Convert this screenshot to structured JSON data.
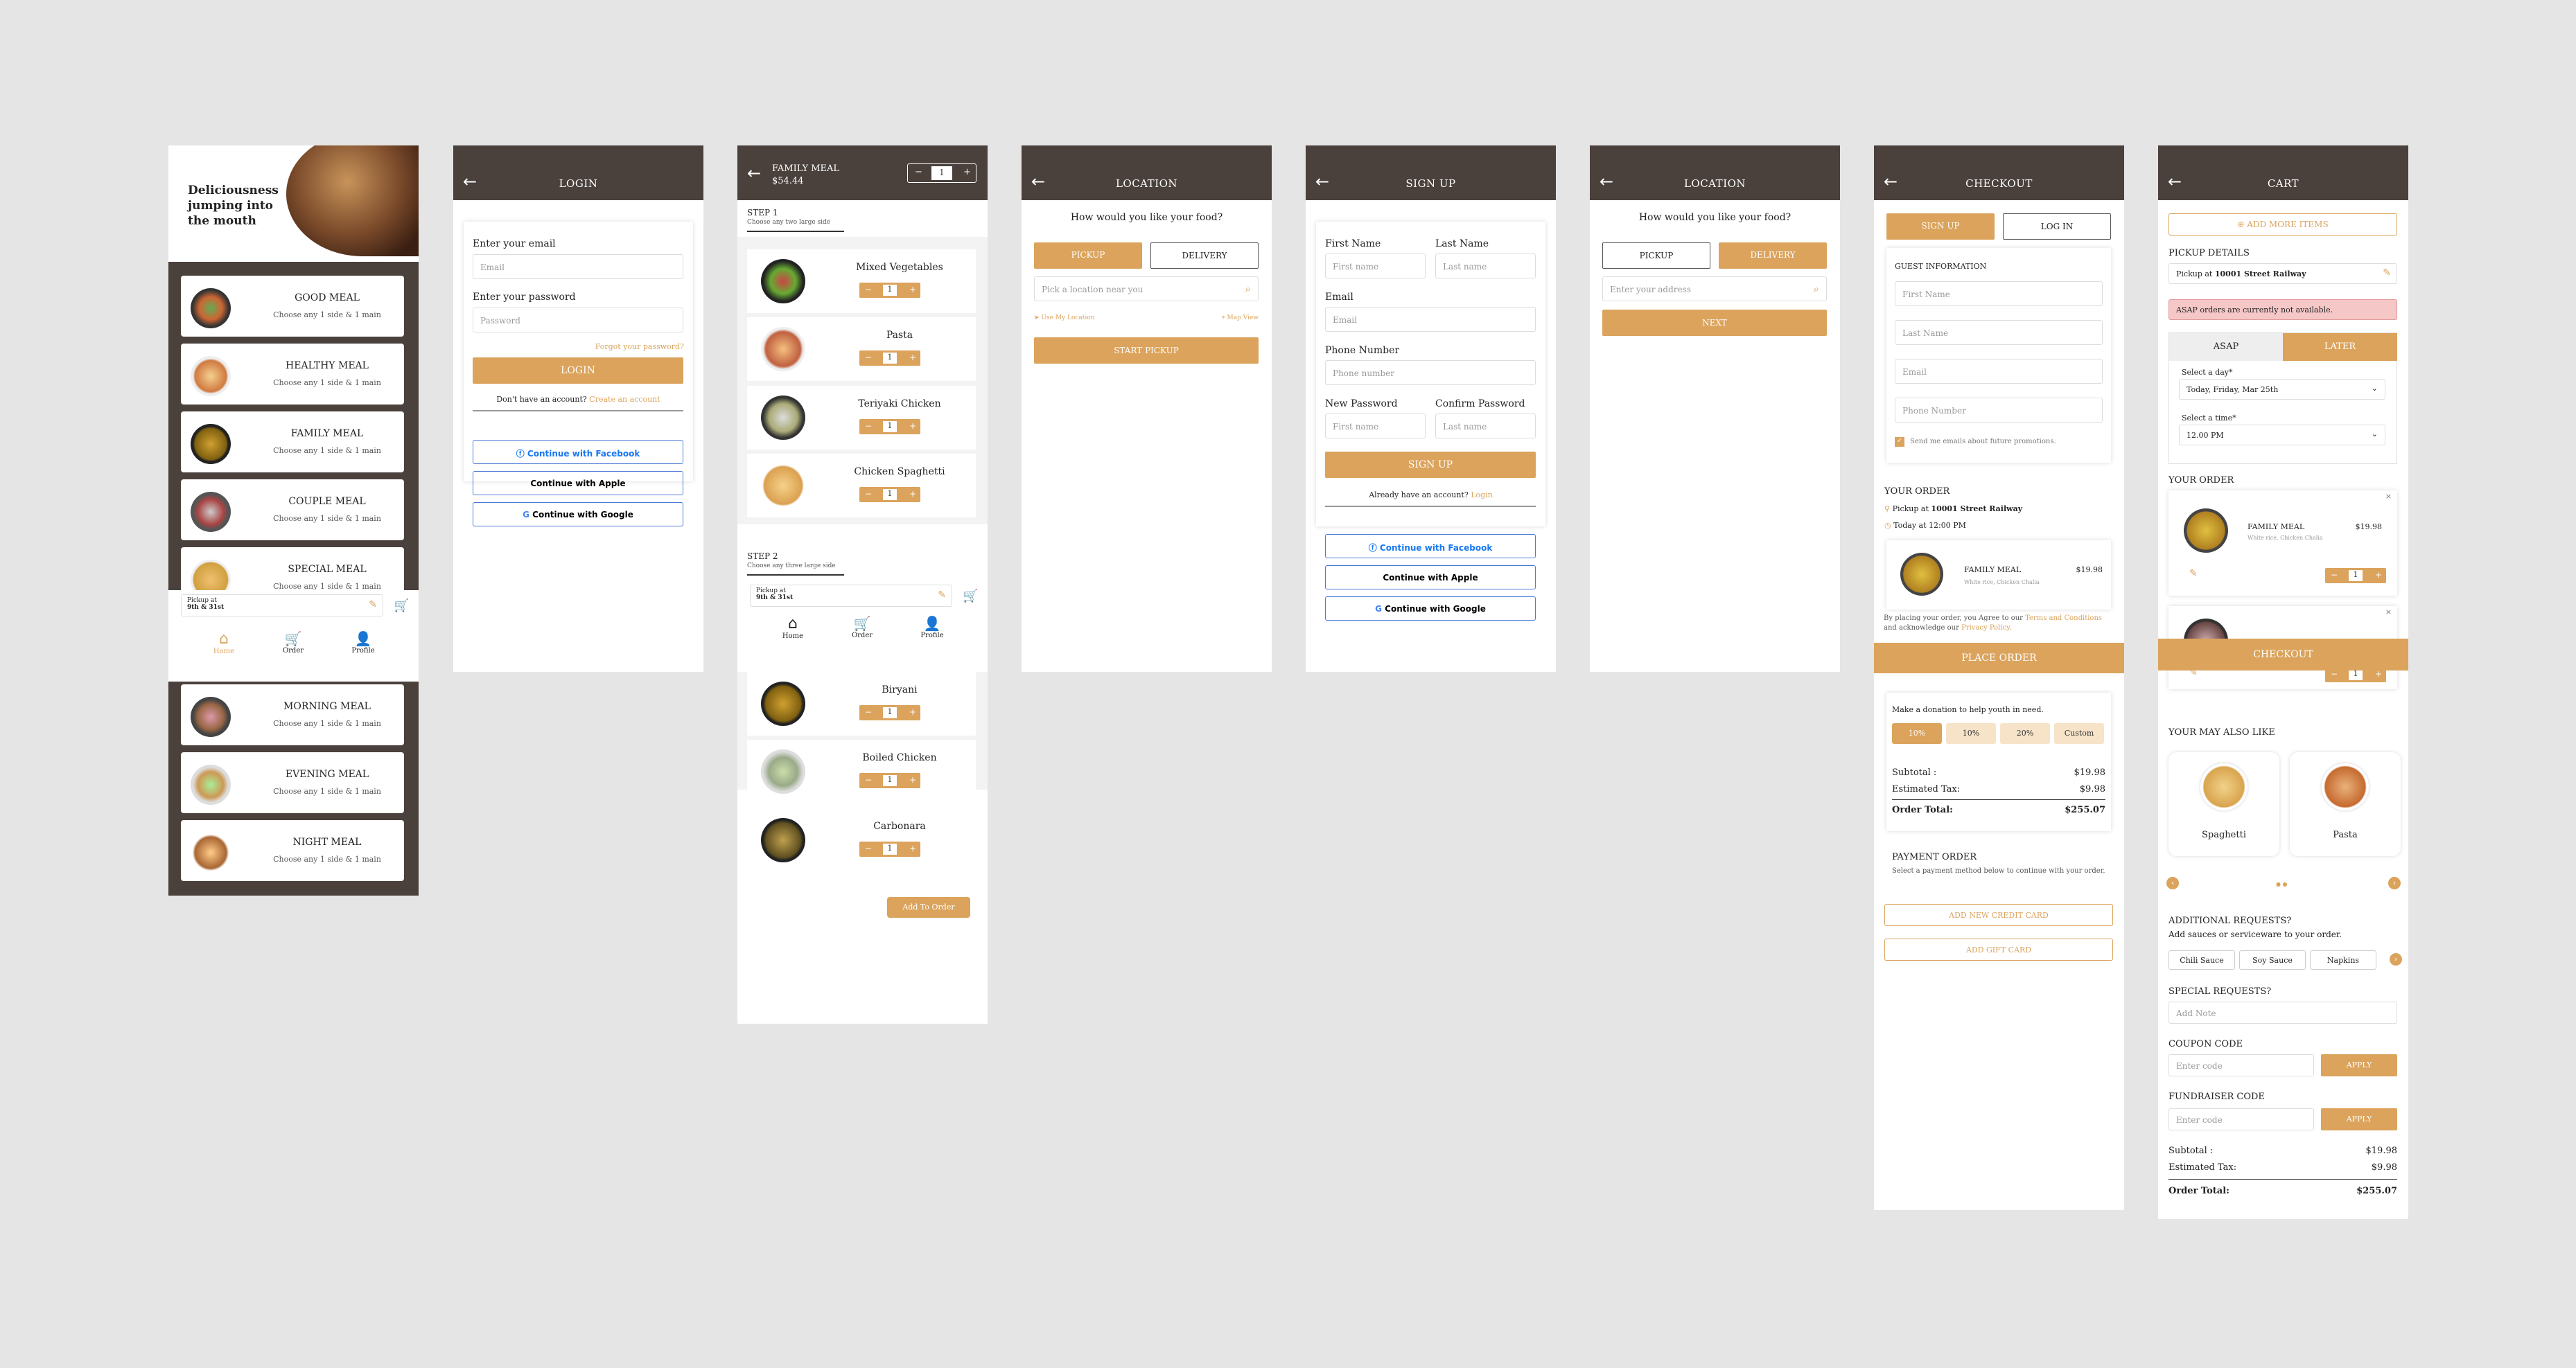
{
  "home": {
    "hero": "Deliciousness jumping into the mouth",
    "meals": [
      {
        "name": "GOOD MEAL",
        "sub": "Choose any 1 side & 1 main"
      },
      {
        "name": "HEALTHY MEAL",
        "sub": "Choose any 1 side & 1 main"
      },
      {
        "name": "FAMILY MEAL",
        "sub": "Choose any 1 side & 1 main"
      },
      {
        "name": "COUPLE MEAL",
        "sub": "Choose any 1 side & 1 main"
      },
      {
        "name": "SPECIAL MEAL",
        "sub": "Choose any 1 side & 1 main"
      },
      {
        "name": "MORNING MEAL",
        "sub": "Choose any 1 side & 1 main"
      },
      {
        "name": "EVENING MEAL",
        "sub": "Choose any 1 side & 1 main"
      },
      {
        "name": "NIGHT MEAL",
        "sub": "Choose any 1 side & 1 main"
      }
    ],
    "pickup_label": "Pickup at",
    "pickup_value": "9th & 31st",
    "nav": {
      "home": "Home",
      "order": "Order",
      "profile": "Profile"
    }
  },
  "login": {
    "title": "LOGIN",
    "email_label": "Enter your email",
    "email_ph": "Email",
    "password_label": "Enter your password",
    "password_ph": "Password",
    "forgot": "Forgot your password?",
    "login_btn": "LOGIN",
    "no_account": "Don't have an account?",
    "create": "Create an account",
    "facebook": "Continue with Facebook",
    "apple": "Continue with Apple",
    "google": "Continue with Google"
  },
  "family": {
    "title": "FAMILY MEAL",
    "price": "$54.44",
    "qty": "1",
    "step1": "STEP 1",
    "step1_sub": "Choose any two large side",
    "items1": [
      {
        "name": "Mixed Vegetables",
        "qty": "1"
      },
      {
        "name": "Pasta",
        "qty": "1"
      },
      {
        "name": "Teriyaki Chicken",
        "qty": "1"
      },
      {
        "name": "Chicken Spaghetti",
        "qty": "1"
      }
    ],
    "step2": "STEP 2",
    "step2_sub": "Choose any three large side",
    "items2": [
      {
        "name": "Biryani",
        "qty": "1"
      },
      {
        "name": "Boiled Chicken",
        "qty": "1"
      },
      {
        "name": "Carbonara",
        "qty": "1"
      }
    ],
    "pickup_label": "Pickup at",
    "pickup_value": "9th & 31st",
    "add": "Add To Order"
  },
  "loc1": {
    "title": "LOCATION",
    "question": "How would you like your food?",
    "pickup": "PICKUP",
    "delivery": "DELIVERY",
    "search_ph": "Pick a location near you",
    "use_loc": "Use My Location",
    "map": "Map View",
    "start": "START PICKUP"
  },
  "signup": {
    "title": "SIGN UP",
    "first": "First Name",
    "last": "Last Name",
    "first_ph": "First name",
    "last_ph": "Last name",
    "email": "Email",
    "email_ph": "Email",
    "phone": "Phone Number",
    "phone_ph": "Phone number",
    "newpw": "New Password",
    "confirmpw": "Confirm Password",
    "newpw_ph": "First name",
    "confirmpw_ph": "Last name",
    "btn": "SIGN UP",
    "already": "Already have an account?",
    "login": "Login",
    "facebook": "Continue with Facebook",
    "apple": "Continue with Apple",
    "google": "Continue with Google"
  },
  "loc2": {
    "title": "LOCATION",
    "question": "How would you like your food?",
    "pickup": "PICKUP",
    "delivery": "DELIVERY",
    "address_ph": "Enter your address",
    "next": "NEXT"
  },
  "checkout": {
    "title": "CHECKOUT",
    "signup": "SIGN UP",
    "login": "LOG IN",
    "guest": "GUEST INFORMATION",
    "first": "First Name",
    "last": "Last Name",
    "email": "Email",
    "phone": "Phone Number",
    "promo": "Send me emails about future promotions.",
    "your_order": "YOUR ORDER",
    "pickup_at": "Pickup at",
    "pickup_addr": "10001 Street Railway",
    "today": "Today at 12:00 PM",
    "item_name": "FAMILY MEAL",
    "item_desc": "White rice, Chicken Chalia",
    "item_price": "$19.98",
    "terms1": "By placing your order, you Agree to our",
    "terms2": "Terms and Conditions",
    "terms3": "and acknowledge our",
    "terms4": "Privacy Policy.",
    "place": "PLACE ORDER",
    "donate": "Make a donation to help youth in need.",
    "donations": [
      "10%",
      "10%",
      "20%",
      "Custom"
    ],
    "subtotal_l": "Subtotal :",
    "subtotal": "$19.98",
    "tax_l": "Estimated Tax:",
    "tax": "$9.98",
    "total_l": "Order Total:",
    "total": "$255.07",
    "payment": "PAYMENT ORDER",
    "payment_sub": "Select a payment method below to continue with your order.",
    "add_card": "ADD NEW CREDIT CARD",
    "add_gift": "ADD GIFT CARD"
  },
  "cart": {
    "title": "CART",
    "add_more": "ADD MORE ITEMS",
    "pickup_details": "PICKUP DETAILS",
    "pickup_text": "Pickup at",
    "pickup_addr": "10001 Street Railway",
    "asap_warn": "ASAP orders are currently not available.",
    "asap": "ASAP",
    "later": "LATER",
    "day_l": "Select a day*",
    "day": "Today, Friday, Mar 25th",
    "time_l": "Select a time*",
    "time": "12.00 PM",
    "your_order": "YOUR ORDER",
    "item1": "FAMILY MEAL",
    "item1_desc": "White rice, Chicken Chalia",
    "item1_price": "$19.98",
    "qty": "1",
    "item2": "FAMILY MEAL",
    "item2_price": "$19.98",
    "checkout": "CHECKOUT",
    "may_like": "YOUR MAY ALSO LIKE",
    "like1": "Spaghetti",
    "like2": "Pasta",
    "additional": "ADDITIONAL REQUESTS?",
    "additional_sub": "Add sauces or serviceware to your order.",
    "chips": [
      "Chili Sauce",
      "Soy Sauce",
      "Napkins"
    ],
    "special": "SPECIAL REQUESTS?",
    "note_ph": "Add Note",
    "coupon": "COUPON CODE",
    "code_ph": "Enter code",
    "apply": "APPLY",
    "fundraiser": "FUNDRAISER CODE",
    "subtotal_l": "Subtotal :",
    "subtotal": "$19.98",
    "tax_l": "Estimated Tax:",
    "tax": "$9.98",
    "total_l": "Order Total:",
    "total": "$255.07"
  }
}
